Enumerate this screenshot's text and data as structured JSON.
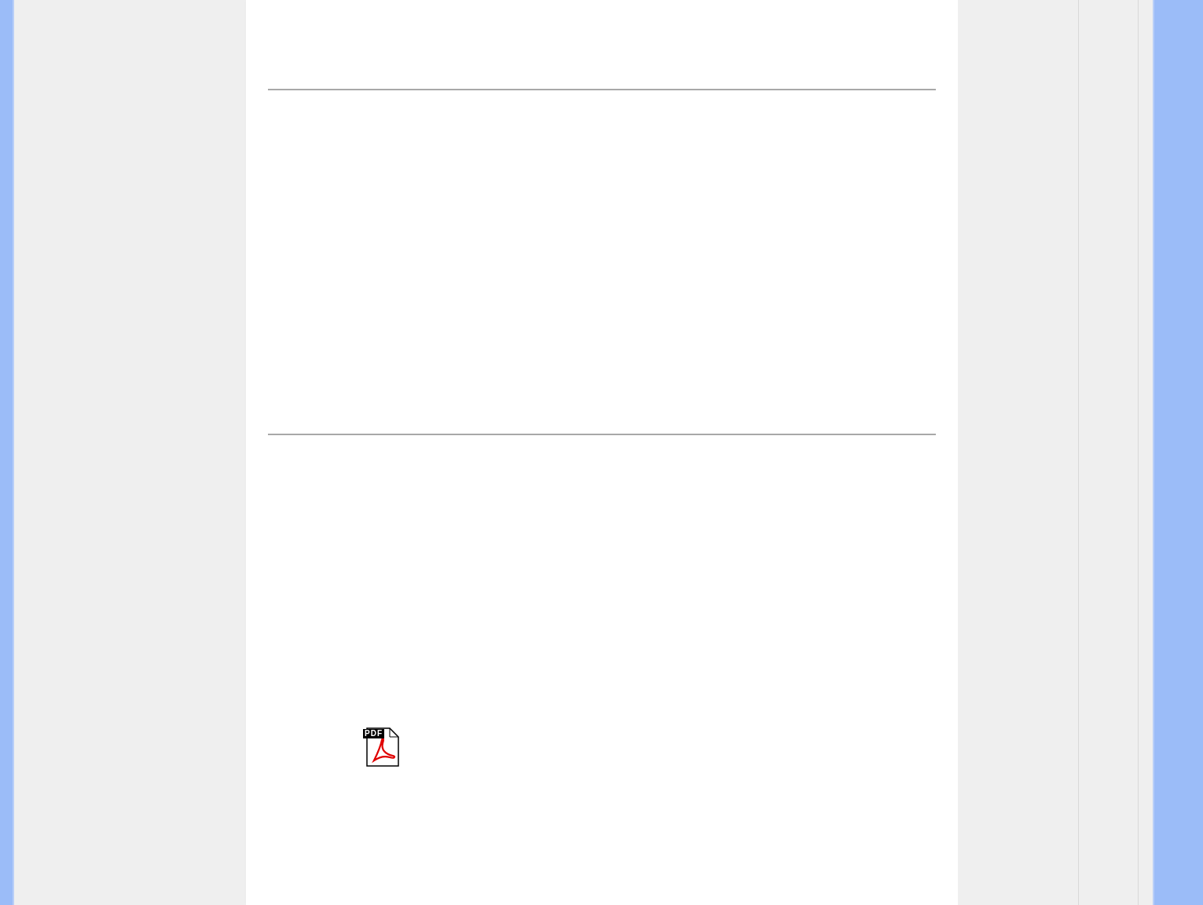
{
  "document": {
    "pdf_icon": {
      "label": "PDF"
    }
  }
}
